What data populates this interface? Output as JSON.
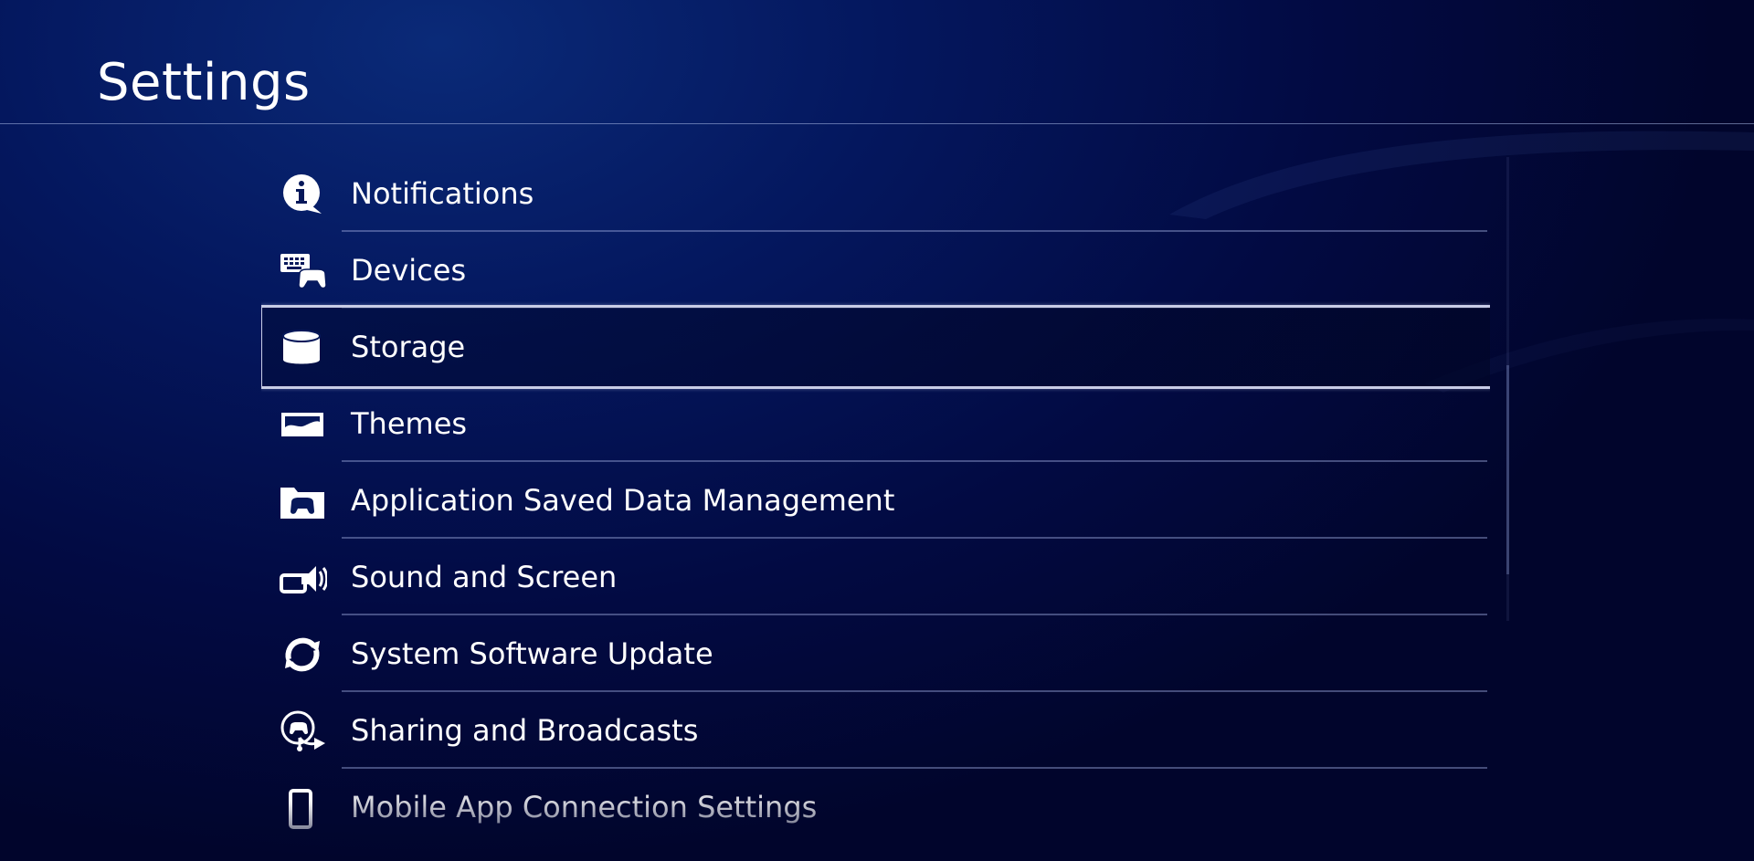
{
  "page": {
    "title": "Settings"
  },
  "colors": {
    "background": "#04175e",
    "focus_border": "#c8cce6",
    "divider": "#7f8fcf"
  },
  "menu": {
    "selected_index": 2,
    "items": [
      {
        "label": "Notifications",
        "icon": "notifications-icon"
      },
      {
        "label": "Devices",
        "icon": "devices-icon"
      },
      {
        "label": "Storage",
        "icon": "storage-icon"
      },
      {
        "label": "Themes",
        "icon": "themes-icon"
      },
      {
        "label": "Application Saved Data Management",
        "icon": "saved-data-icon"
      },
      {
        "label": "Sound and Screen",
        "icon": "sound-and-screen-icon"
      },
      {
        "label": "System Software Update",
        "icon": "system-update-icon"
      },
      {
        "label": "Sharing and Broadcasts",
        "icon": "sharing-broadcasts-icon"
      },
      {
        "label": "Mobile App Connection Settings",
        "icon": "mobile-app-icon"
      }
    ]
  },
  "scrollbar": {
    "position_fraction": 0.45,
    "visible_fraction": 0.45
  }
}
